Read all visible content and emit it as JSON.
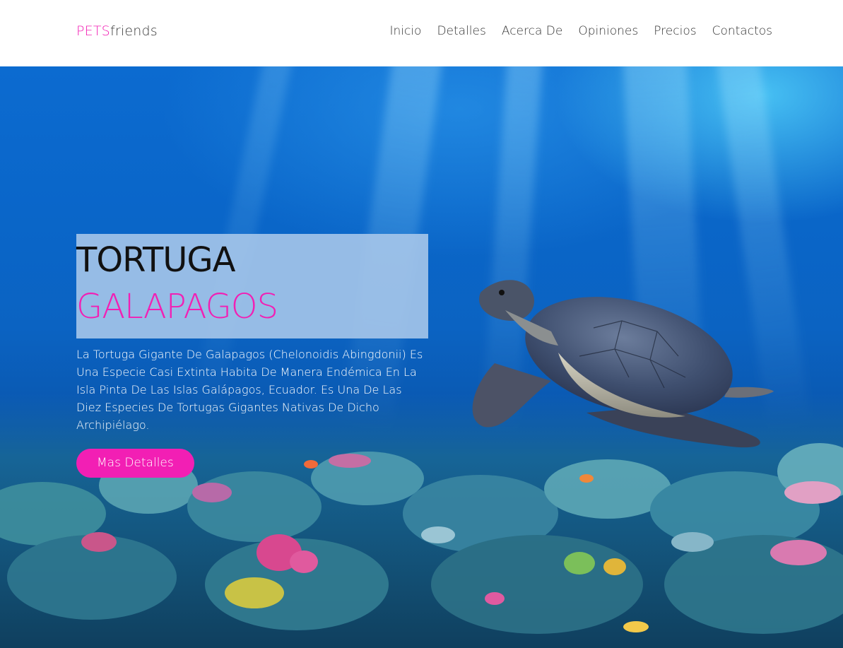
{
  "header": {
    "logo_brand": "PETS",
    "logo_suffix": "friends",
    "nav": [
      {
        "label": "Inicio"
      },
      {
        "label": "Detalles"
      },
      {
        "label": "Acerca De"
      },
      {
        "label": "Opiniones"
      },
      {
        "label": "Precios"
      },
      {
        "label": "Contactos"
      }
    ]
  },
  "hero": {
    "title_line1": "TORTUGA",
    "title_line2": "GALAPAGOS",
    "description": "La Tortuga Gigante De Galapagos (Chelonoidis Abingdonii) Es Una Especie Casi Extinta Habita De Manera Endémica En La Isla Pinta De Las Islas Galápagos, Ecuador. Es Una De Las Diez Especies De Tortugas Gigantes Nativas De Dicho Archipiélago.",
    "cta_label": "Mas Detalles"
  },
  "colors": {
    "accent": "#f21fb4",
    "highlight": "#aac8eb",
    "ocean": "#0a66c9"
  }
}
